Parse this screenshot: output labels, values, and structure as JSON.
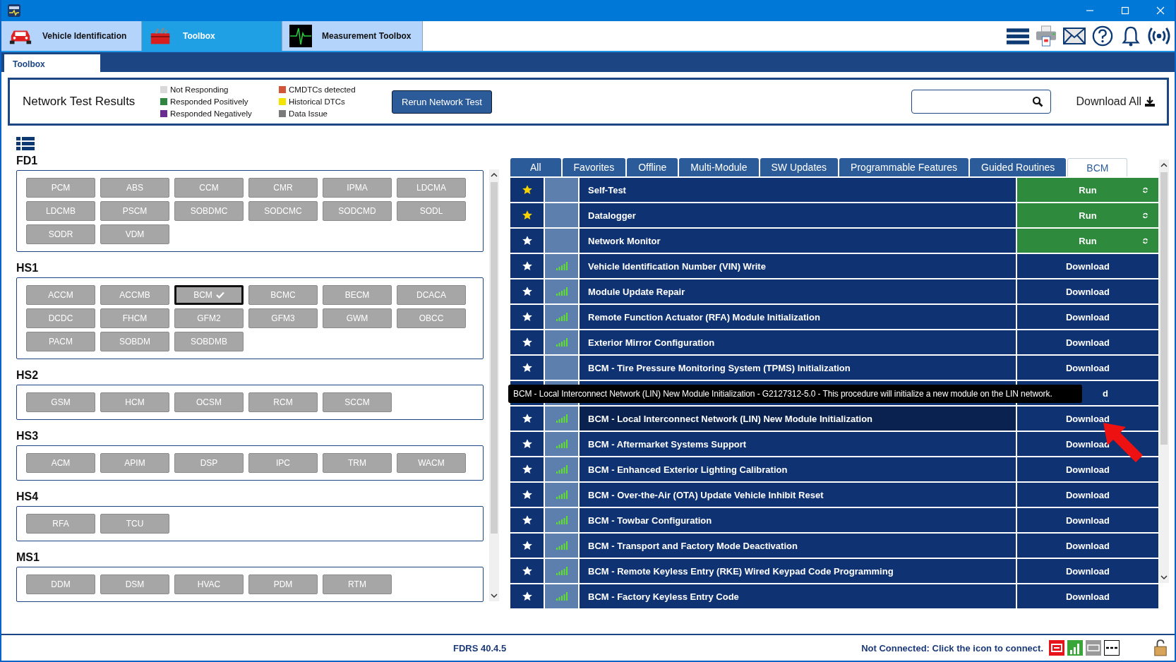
{
  "app_tabs": [
    {
      "label": "Vehicle Identification",
      "selected": false,
      "kind": "vehicle"
    },
    {
      "label": "Toolbox",
      "selected": true,
      "kind": "toolbox"
    },
    {
      "label": "Measurement Toolbox",
      "selected": false,
      "kind": "measurement"
    }
  ],
  "subtabs": [
    {
      "label": "Toolbox",
      "selected": true
    }
  ],
  "results": {
    "title": "Network Test Results",
    "legend": [
      {
        "label": "Not Responding",
        "color": "#d9d9d9"
      },
      {
        "label": "Responded Positively",
        "color": "#2e8540"
      },
      {
        "label": "Responded Negatively",
        "color": "#6a2c91"
      },
      {
        "label": "CMDTCs detected",
        "color": "#d2553a"
      },
      {
        "label": "Historical DTCs",
        "color": "#f5e400"
      },
      {
        "label": "Data Issue",
        "color": "#7a7a7a"
      }
    ],
    "rerun_button": "Rerun Network Test",
    "download_all": "Download All"
  },
  "groups": [
    {
      "name": "FD1",
      "modules": [
        {
          "label": "PCM",
          "selected": false
        },
        {
          "label": "ABS",
          "selected": false
        },
        {
          "label": "CCM",
          "selected": false
        },
        {
          "label": "CMR",
          "selected": false
        },
        {
          "label": "IPMA",
          "selected": false
        },
        {
          "label": "LDCMA",
          "selected": false
        },
        {
          "label": "LDCMB",
          "selected": false
        },
        {
          "label": "PSCM",
          "selected": false
        },
        {
          "label": "SOBDMC",
          "selected": false
        },
        {
          "label": "SODCMC",
          "selected": false
        },
        {
          "label": "SODCMD",
          "selected": false
        },
        {
          "label": "SODL",
          "selected": false
        },
        {
          "label": "SODR",
          "selected": false
        },
        {
          "label": "VDM",
          "selected": false
        }
      ]
    },
    {
      "name": "HS1",
      "modules": [
        {
          "label": "ACCM",
          "selected": false
        },
        {
          "label": "ACCMB",
          "selected": false
        },
        {
          "label": "BCM",
          "selected": true
        },
        {
          "label": "BCMC",
          "selected": false
        },
        {
          "label": "BECM",
          "selected": false
        },
        {
          "label": "DCACA",
          "selected": false
        },
        {
          "label": "DCDC",
          "selected": false
        },
        {
          "label": "FHCM",
          "selected": false
        },
        {
          "label": "GFM2",
          "selected": false
        },
        {
          "label": "GFM3",
          "selected": false
        },
        {
          "label": "GWM",
          "selected": false
        },
        {
          "label": "OBCC",
          "selected": false
        },
        {
          "label": "PACM",
          "selected": false
        },
        {
          "label": "SOBDM",
          "selected": false
        },
        {
          "label": "SOBDMB",
          "selected": false
        }
      ]
    },
    {
      "name": "HS2",
      "modules": [
        {
          "label": "GSM",
          "selected": false
        },
        {
          "label": "HCM",
          "selected": false
        },
        {
          "label": "OCSM",
          "selected": false
        },
        {
          "label": "RCM",
          "selected": false
        },
        {
          "label": "SCCM",
          "selected": false
        }
      ]
    },
    {
      "name": "HS3",
      "modules": [
        {
          "label": "ACM",
          "selected": false
        },
        {
          "label": "APIM",
          "selected": false
        },
        {
          "label": "DSP",
          "selected": false
        },
        {
          "label": "IPC",
          "selected": false
        },
        {
          "label": "TRM",
          "selected": false
        },
        {
          "label": "WACM",
          "selected": false
        }
      ]
    },
    {
      "name": "HS4",
      "modules": [
        {
          "label": "RFA",
          "selected": false
        },
        {
          "label": "TCU",
          "selected": false
        }
      ]
    },
    {
      "name": "MS1",
      "modules": [
        {
          "label": "DDM",
          "selected": false
        },
        {
          "label": "DSM",
          "selected": false
        },
        {
          "label": "HVAC",
          "selected": false
        },
        {
          "label": "PDM",
          "selected": false
        },
        {
          "label": "RTM",
          "selected": false
        }
      ]
    }
  ],
  "procedure_tabs": [
    {
      "label": "All",
      "selected": false
    },
    {
      "label": "Favorites",
      "selected": false
    },
    {
      "label": "Offline",
      "selected": false
    },
    {
      "label": "Multi-Module",
      "selected": false
    },
    {
      "label": "SW Updates",
      "selected": false
    },
    {
      "label": "Programmable Features",
      "selected": false
    },
    {
      "label": "Guided Routines",
      "selected": false
    },
    {
      "label": "BCM",
      "selected": true
    }
  ],
  "procedures": [
    {
      "kind": "run",
      "name": "Self-Test",
      "favorite": true,
      "signal": false,
      "hovered": false,
      "action": "Run"
    },
    {
      "kind": "run",
      "name": "Datalogger",
      "favorite": true,
      "signal": false,
      "hovered": false,
      "action": "Run"
    },
    {
      "kind": "run",
      "name": "Network Monitor",
      "favorite": false,
      "signal": false,
      "hovered": false,
      "action": "Run"
    },
    {
      "kind": "download",
      "name": "Vehicle Identification Number (VIN) Write",
      "favorite": false,
      "signal": true,
      "hovered": false,
      "action": "Download"
    },
    {
      "kind": "download",
      "name": "Module Update Repair",
      "favorite": false,
      "signal": true,
      "hovered": false,
      "action": "Download"
    },
    {
      "kind": "download",
      "name": "Remote Function Actuator (RFA) Module Initialization",
      "favorite": false,
      "signal": true,
      "hovered": false,
      "action": "Download"
    },
    {
      "kind": "download",
      "name": "Exterior Mirror Configuration",
      "favorite": false,
      "signal": true,
      "hovered": false,
      "action": "Download"
    },
    {
      "kind": "download",
      "name": "BCM - Tire Pressure Monitoring System (TPMS) Initialization",
      "favorite": false,
      "signal": false,
      "hovered": false,
      "action": "Download"
    },
    {
      "kind": "covered",
      "action": "d",
      "tooltip": "BCM - Local Interconnect Network (LIN) New Module Initialization - G2127312-5.0 - This procedure will initialize a new module on the LIN network."
    },
    {
      "kind": "download",
      "name": "BCM - Local Interconnect Network (LIN) New Module Initialization",
      "favorite": false,
      "signal": true,
      "hovered": true,
      "action": "Download"
    },
    {
      "kind": "download",
      "name": "BCM - Aftermarket Systems Support",
      "favorite": false,
      "signal": true,
      "hovered": false,
      "action": "Download"
    },
    {
      "kind": "download",
      "name": "BCM - Enhanced Exterior Lighting Calibration",
      "favorite": false,
      "signal": true,
      "hovered": false,
      "action": "Download"
    },
    {
      "kind": "download",
      "name": "BCM - Over-the-Air (OTA) Update Vehicle Inhibit Reset",
      "favorite": false,
      "signal": true,
      "hovered": false,
      "action": "Download"
    },
    {
      "kind": "download",
      "name": "BCM - Towbar Configuration",
      "favorite": false,
      "signal": true,
      "hovered": false,
      "action": "Download"
    },
    {
      "kind": "download",
      "name": "BCM - Transport and Factory Mode Deactivation",
      "favorite": false,
      "signal": true,
      "hovered": false,
      "action": "Download"
    },
    {
      "kind": "download",
      "name": "BCM - Remote Keyless Entry (RKE) Wired Keypad Code Programming",
      "favorite": false,
      "signal": true,
      "hovered": false,
      "action": "Download"
    },
    {
      "kind": "download",
      "name": "BCM - Factory Keyless Entry Code",
      "favorite": false,
      "signal": true,
      "hovered": false,
      "action": "Download"
    }
  ],
  "status_bar": {
    "version": "FDRS 40.4.5",
    "connection": "Not Connected: Click the icon to connect."
  }
}
